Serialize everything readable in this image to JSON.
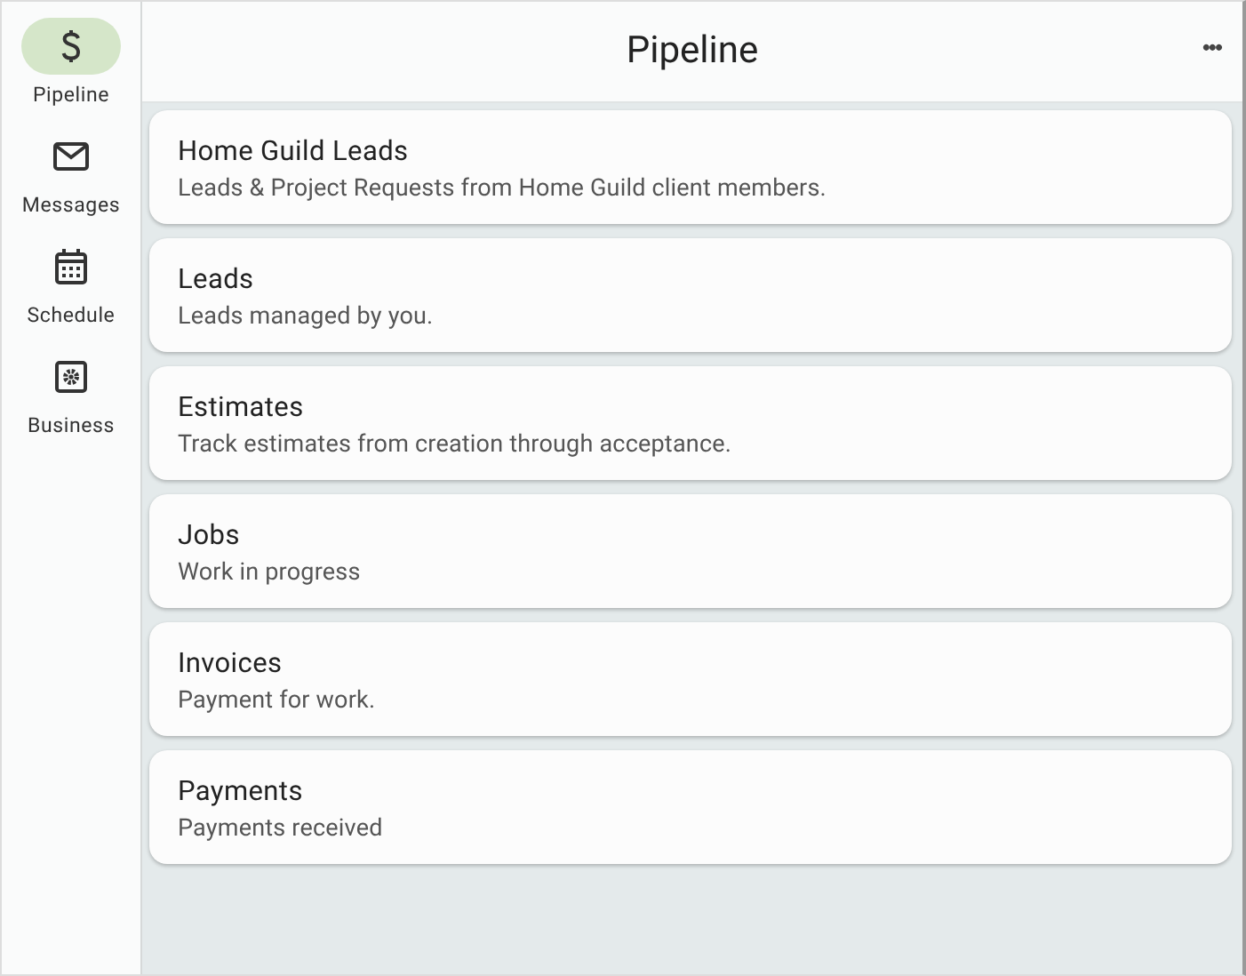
{
  "nav": [
    {
      "label": "Pipeline",
      "selected": true
    },
    {
      "label": "Messages",
      "selected": false
    },
    {
      "label": "Schedule",
      "selected": false
    },
    {
      "label": "Business",
      "selected": false
    }
  ],
  "header": {
    "title": "Pipeline",
    "menu": "•••"
  },
  "cards": [
    {
      "title": "Home Guild Leads",
      "subtitle": "Leads & Project Requests from Home Guild client members."
    },
    {
      "title": "Leads",
      "subtitle": "Leads managed by you."
    },
    {
      "title": "Estimates",
      "subtitle": "Track estimates from creation through acceptance."
    },
    {
      "title": "Jobs",
      "subtitle": "Work in progress"
    },
    {
      "title": "Invoices",
      "subtitle": "Payment for work."
    },
    {
      "title": "Payments",
      "subtitle": "Payments received"
    }
  ]
}
